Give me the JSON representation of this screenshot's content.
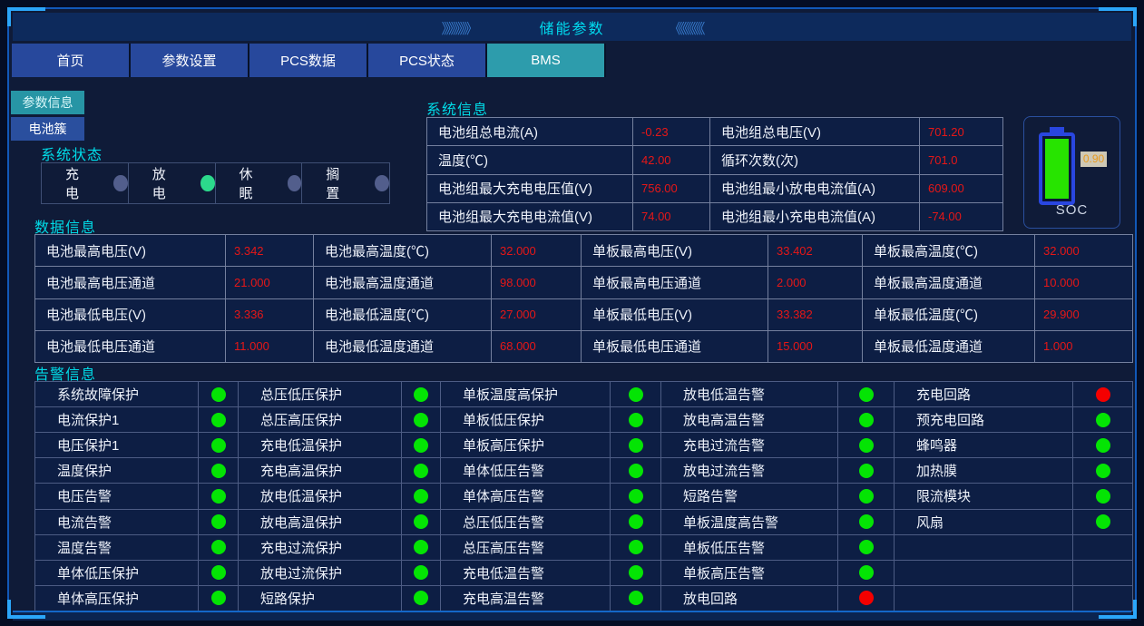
{
  "header": {
    "title": "储能参数"
  },
  "icons": {
    "right_chevrons": "》》》》》》",
    "left_chevrons": "《《《《《《"
  },
  "tabs": [
    {
      "label": "首页",
      "active": false
    },
    {
      "label": "参数设置",
      "active": false
    },
    {
      "label": "PCS数据",
      "active": false
    },
    {
      "label": "PCS状态",
      "active": false
    },
    {
      "label": "BMS",
      "active": true
    }
  ],
  "side_buttons": [
    {
      "label": "参数信息",
      "active": true
    },
    {
      "label": "电池簇",
      "active": false
    }
  ],
  "colors": {
    "accent_cyan": "#00dce8",
    "tab_active_teal": "#2d9cac",
    "tab_blue": "#27489c",
    "value_red": "#e61717",
    "alarm_green": "#04e404",
    "alarm_red": "#f40000",
    "status_on_green": "#2cd98c",
    "status_off_slate": "#525e8c",
    "battery_fill_green": "#27e400",
    "soc_value_orange": "#e89a1e"
  },
  "system_status": {
    "title": "系统状态",
    "items": [
      {
        "label": "充电",
        "on": false
      },
      {
        "label": "放电",
        "on": true
      },
      {
        "label": "休眠",
        "on": false
      },
      {
        "label": "搁置",
        "on": false
      }
    ]
  },
  "system_info": {
    "title": "系统信息",
    "rows": [
      [
        {
          "label": "电池组总电流(A)",
          "value": "-0.23"
        },
        {
          "label": "电池组总电压(V)",
          "value": "701.20"
        }
      ],
      [
        {
          "label": "温度(℃)",
          "value": "42.00"
        },
        {
          "label": "循环次数(次)",
          "value": "701.0"
        }
      ],
      [
        {
          "label": "电池组最大充电电压值(V)",
          "value": "756.00"
        },
        {
          "label": "电池组最小放电电流值(A)",
          "value": "609.00"
        }
      ],
      [
        {
          "label": "电池组最大充电电流值(V)",
          "value": "74.00"
        },
        {
          "label": "电池组最小充电电流值(A)",
          "value": "-74.00"
        }
      ]
    ]
  },
  "soc": {
    "label": "SOC",
    "value": "0.90"
  },
  "data_info": {
    "title": "数据信息",
    "rows": [
      [
        {
          "label": "电池最高电压(V)",
          "value": "3.342"
        },
        {
          "label": "电池最高温度(℃)",
          "value": "32.000"
        },
        {
          "label": "单板最高电压(V)",
          "value": "33.402"
        },
        {
          "label": "单板最高温度(℃)",
          "value": "32.000"
        }
      ],
      [
        {
          "label": "电池最高电压通道",
          "value": "21.000"
        },
        {
          "label": "电池最高温度通道",
          "value": "98.000"
        },
        {
          "label": "单板最高电压通道",
          "value": "2.000"
        },
        {
          "label": "单板最高温度通道",
          "value": "10.000"
        }
      ],
      [
        {
          "label": "电池最低电压(V)",
          "value": "3.336"
        },
        {
          "label": "电池最低温度(℃)",
          "value": "27.000"
        },
        {
          "label": "单板最低电压(V)",
          "value": "33.382"
        },
        {
          "label": "单板最低温度(℃)",
          "value": "29.900"
        }
      ],
      [
        {
          "label": "电池最低电压通道",
          "value": "11.000"
        },
        {
          "label": "电池最低温度通道",
          "value": "68.000"
        },
        {
          "label": "单板最低电压通道",
          "value": "15.000"
        },
        {
          "label": "单板最低温度通道",
          "value": "1.000"
        }
      ]
    ]
  },
  "alarm_info": {
    "title": "告警信息",
    "rows": [
      [
        {
          "label": "系统故障保护",
          "status": "g"
        },
        {
          "label": "总压低压保护",
          "status": "g"
        },
        {
          "label": "单板温度高保护",
          "status": "g"
        },
        {
          "label": "放电低温告警",
          "status": "g"
        },
        {
          "label": "充电回路",
          "status": "r"
        }
      ],
      [
        {
          "label": "电流保护1",
          "status": "g"
        },
        {
          "label": "总压高压保护",
          "status": "g"
        },
        {
          "label": "单板低压保护",
          "status": "g"
        },
        {
          "label": "放电高温告警",
          "status": "g"
        },
        {
          "label": "预充电回路",
          "status": "g"
        }
      ],
      [
        {
          "label": "电压保护1",
          "status": "g"
        },
        {
          "label": "充电低温保护",
          "status": "g"
        },
        {
          "label": "单板高压保护",
          "status": "g"
        },
        {
          "label": "充电过流告警",
          "status": "g"
        },
        {
          "label": "蜂鸣器",
          "status": "g"
        }
      ],
      [
        {
          "label": "温度保护",
          "status": "g"
        },
        {
          "label": "充电高温保护",
          "status": "g"
        },
        {
          "label": "单体低压告警",
          "status": "g"
        },
        {
          "label": "放电过流告警",
          "status": "g"
        },
        {
          "label": "加热膜",
          "status": "g"
        }
      ],
      [
        {
          "label": "电压告警",
          "status": "g"
        },
        {
          "label": "放电低温保护",
          "status": "g"
        },
        {
          "label": "单体高压告警",
          "status": "g"
        },
        {
          "label": "短路告警",
          "status": "g"
        },
        {
          "label": "限流模块",
          "status": "g"
        }
      ],
      [
        {
          "label": "电流告警",
          "status": "g"
        },
        {
          "label": "放电高温保护",
          "status": "g"
        },
        {
          "label": "总压低压告警",
          "status": "g"
        },
        {
          "label": "单板温度高告警",
          "status": "g"
        },
        {
          "label": "风扇",
          "status": "g"
        }
      ],
      [
        {
          "label": "温度告警",
          "status": "g"
        },
        {
          "label": "充电过流保护",
          "status": "g"
        },
        {
          "label": "总压高压告警",
          "status": "g"
        },
        {
          "label": "单板低压告警",
          "status": "g"
        },
        {
          "label": "",
          "status": ""
        }
      ],
      [
        {
          "label": "单体低压保护",
          "status": "g"
        },
        {
          "label": "放电过流保护",
          "status": "g"
        },
        {
          "label": "充电低温告警",
          "status": "g"
        },
        {
          "label": "单板高压告警",
          "status": "g"
        },
        {
          "label": "",
          "status": ""
        }
      ],
      [
        {
          "label": "单体高压保护",
          "status": "g"
        },
        {
          "label": "短路保护",
          "status": "g"
        },
        {
          "label": "充电高温告警",
          "status": "g"
        },
        {
          "label": "放电回路",
          "status": "r"
        },
        {
          "label": "",
          "status": ""
        }
      ]
    ]
  }
}
